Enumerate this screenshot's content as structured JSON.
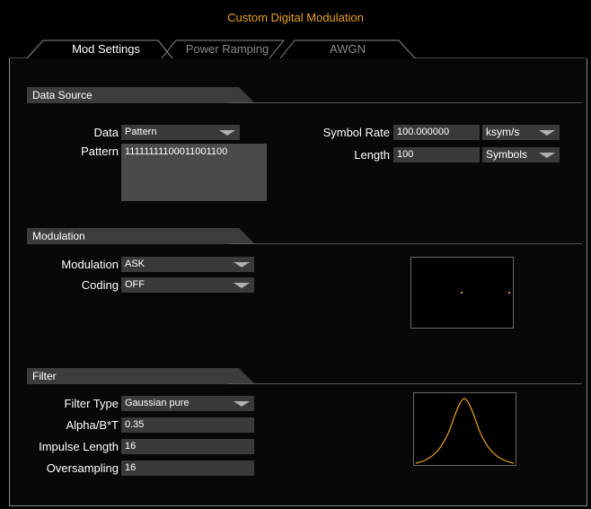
{
  "window": {
    "title": "Custom Digital Modulation"
  },
  "tabs": [
    {
      "label": "Mod Settings",
      "active": true
    },
    {
      "label": "Power Ramping",
      "active": false
    },
    {
      "label": "AWGN",
      "active": false
    }
  ],
  "data_source": {
    "header": "Data Source",
    "data_label": "Data",
    "data_value": "Pattern",
    "pattern_label": "Pattern",
    "pattern_value": "11111111100011001100",
    "symbol_rate_label": "Symbol Rate",
    "symbol_rate_value": "100.000000",
    "symbol_rate_unit": "ksym/s",
    "length_label": "Length",
    "length_value": "100",
    "length_unit": "Symbols"
  },
  "modulation": {
    "header": "Modulation",
    "modulation_label": "Modulation",
    "modulation_value": "ASK",
    "coding_label": "Coding",
    "coding_value": "OFF"
  },
  "filter": {
    "header": "Filter",
    "filter_type_label": "Filter Type",
    "filter_type_value": "Gaussian pure",
    "alpha_label": "Alpha/B*T",
    "alpha_value": "0.35",
    "impulse_length_label": "Impulse Length",
    "impulse_length_value": "16",
    "oversampling_label": "Oversampling",
    "oversampling_value": "16"
  },
  "colors": {
    "accent": "#e8a020",
    "field_bg": "#3a3a3a",
    "header_bg": "#3c3c3c"
  }
}
